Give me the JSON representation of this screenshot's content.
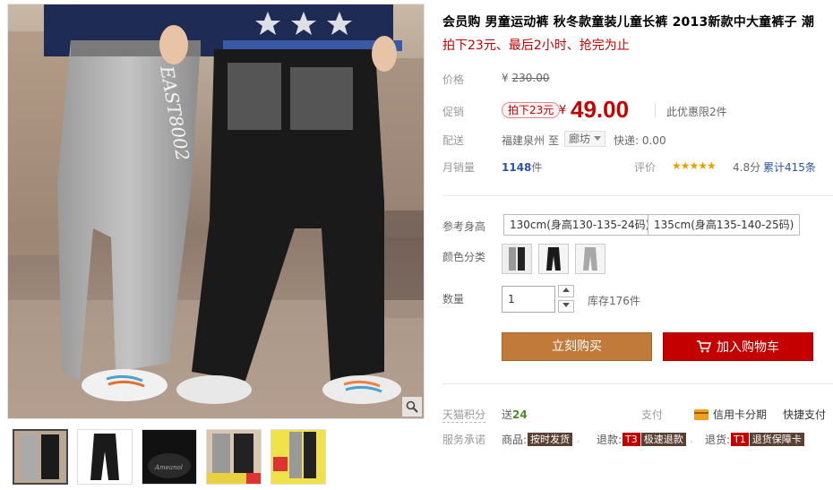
{
  "product": {
    "title": "会员购 男童运动裤 秋冬款童装儿童长裤 2013新款中大童裤子 潮",
    "subtitle": "拍下23元、最后2小时、抢完为止"
  },
  "price": {
    "label": "价格",
    "currency": "¥",
    "original": "230.00"
  },
  "promo": {
    "label": "促销",
    "tag": "拍下23元",
    "currency": "¥",
    "price": "49.00",
    "limit": "此优惠限2件"
  },
  "shipping": {
    "label": "配送",
    "from": "福建泉州",
    "to": "至",
    "destination": "廊坊",
    "fee": "快递: 0.00"
  },
  "sales": {
    "label": "月销量",
    "count": "1148",
    "unit": "件",
    "rating_label": "评价",
    "stars": "★★★★★",
    "score": "4.8分",
    "reviews": "累计415条"
  },
  "sku": {
    "size_label": "参考身高",
    "sizes": [
      "130cm(身高130-135-24码)",
      "135cm(身高135-140-25码)"
    ],
    "color_label": "颜色分类",
    "qty_label": "数量",
    "qty_value": "1",
    "stock": "库存176件"
  },
  "actions": {
    "buy": "立刻购买",
    "cart": "加入购物车"
  },
  "footer": {
    "points_label": "天猫积分",
    "points_prefix": "送",
    "points_value": "24",
    "pay_label": "支付",
    "pay_card": "信用卡分期",
    "pay_fast": "快捷支付",
    "service_label": "服务承诺",
    "svc1_prefix": "商品:",
    "svc1_badge": "按时发货",
    "svc2_prefix": "退款:",
    "svc2_code": "T3",
    "svc2_badge": "极速退款",
    "svc3_prefix": "退货:",
    "svc3_code": "T1",
    "svc3_badge": "退货保障卡"
  },
  "colors": {
    "price_red": "#c40000",
    "buy_bg": "#c07a3a",
    "cart_bg": "#c40000",
    "link_blue": "#2953a6",
    "points_green": "#4c8a2b"
  },
  "icons": [
    "zoom-icon",
    "cart-icon",
    "card-icon",
    "chevron-down-icon",
    "up-arrow-icon",
    "down-arrow-icon"
  ]
}
